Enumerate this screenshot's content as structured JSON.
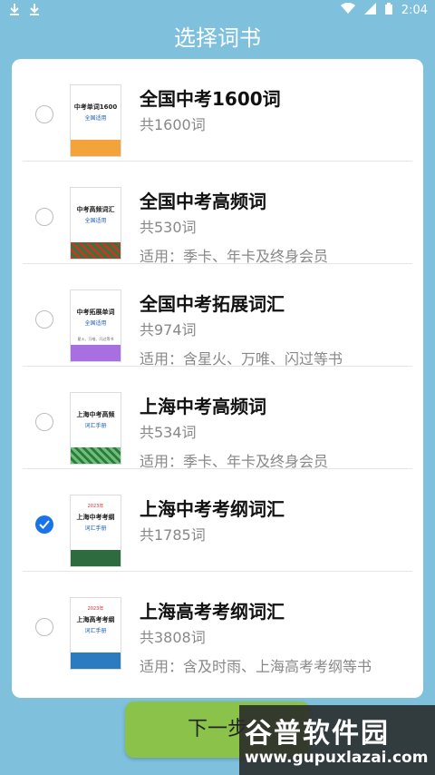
{
  "status_bar": {
    "time": "2:04",
    "left_icons": [
      "download-icon",
      "download-icon"
    ],
    "right_icons": [
      "wifi-icon",
      "signal-icon",
      "battery-icon"
    ]
  },
  "header": {
    "title": "选择词书"
  },
  "books": [
    {
      "title": "全国中考1600词",
      "count": "共1600词",
      "note": "",
      "cover": {
        "year": "",
        "title": "中考单词1600",
        "subtitle": "全国适用",
        "note": "",
        "band": "orange"
      },
      "selected": false
    },
    {
      "title": "全国中考高频词",
      "count": "共530词",
      "note": "适用：季卡、年卡及终身会员",
      "cover": {
        "year": "",
        "title": "中考高频词汇",
        "subtitle": "全国适用",
        "note": "",
        "band": "check-red"
      },
      "selected": false
    },
    {
      "title": "全国中考拓展词汇",
      "count": "共974词",
      "note": "适用：含星火、万唯、闪过等书",
      "cover": {
        "year": "",
        "title": "中考拓展单词",
        "subtitle": "全国适用",
        "note": "星火、万唯、闪过等书",
        "band": "purple"
      },
      "selected": false
    },
    {
      "title": "上海中考高频词",
      "count": "共534词",
      "note": "适用：季卡、年卡及终身会员",
      "cover": {
        "year": "",
        "title": "上海中考高频",
        "subtitle": "词汇手册",
        "note": "",
        "band": "check-green"
      },
      "selected": false
    },
    {
      "title": "上海中考考纲词汇",
      "count": "共1785词",
      "note": "",
      "cover": {
        "year": "2023年",
        "title": "上海中考考纲",
        "subtitle": "词汇手册",
        "note": "",
        "band": "green"
      },
      "selected": true
    },
    {
      "title": "上海高考考纲词汇",
      "count": "共3808词",
      "note": "适用：含及时雨、上海高考考纲等书",
      "cover": {
        "year": "2023年",
        "title": "上海高考考纲",
        "subtitle": "词汇手册",
        "note": "",
        "band": "blue"
      },
      "selected": false
    }
  ],
  "next_button": {
    "label": "下一步"
  },
  "watermark": {
    "brand": "谷普软件园",
    "url": "www.gupuxlazai.com"
  },
  "colors": {
    "background": "#7fc1dd",
    "accent": "#1a73e8",
    "button": "#8bc34a"
  }
}
